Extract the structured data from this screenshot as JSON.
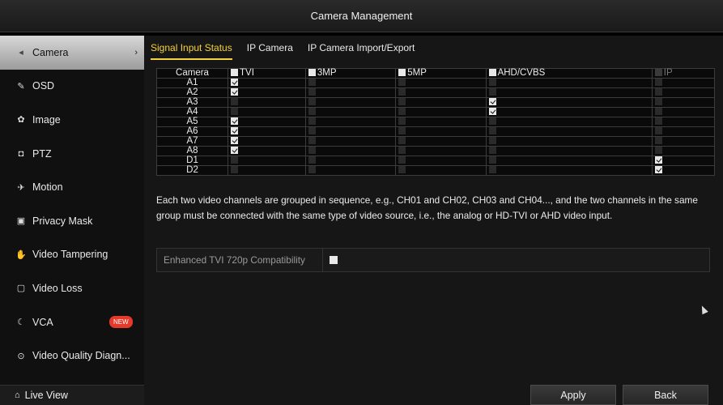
{
  "window": {
    "title": "Camera Management"
  },
  "sidebar": {
    "items": [
      {
        "label": "Camera",
        "icon": "camera-icon",
        "glyph": "◂",
        "active": true
      },
      {
        "label": "OSD",
        "icon": "osd-icon",
        "glyph": "✎"
      },
      {
        "label": "Image",
        "icon": "image-icon",
        "glyph": "✿"
      },
      {
        "label": "PTZ",
        "icon": "ptz-icon",
        "glyph": "◘"
      },
      {
        "label": "Motion",
        "icon": "motion-icon",
        "glyph": "✈"
      },
      {
        "label": "Privacy Mask",
        "icon": "privacy-mask-icon",
        "glyph": "▣"
      },
      {
        "label": "Video Tampering",
        "icon": "video-tampering-icon",
        "glyph": "✋"
      },
      {
        "label": "Video Loss",
        "icon": "video-loss-icon",
        "glyph": "▢"
      },
      {
        "label": "VCA",
        "icon": "vca-icon",
        "glyph": "☾",
        "badge": "NEW"
      },
      {
        "label": "Video Quality Diagn...",
        "icon": "video-quality-icon",
        "glyph": "⊙"
      }
    ],
    "live_view": {
      "label": "Live View",
      "icon": "home-icon",
      "glyph": "⌂"
    }
  },
  "tabs": [
    {
      "label": "Signal Input Status",
      "active": true
    },
    {
      "label": "IP Camera"
    },
    {
      "label": "IP Camera Import/Export"
    }
  ],
  "table": {
    "headers": [
      {
        "label": "Camera"
      },
      {
        "label": "TVI",
        "checked": true
      },
      {
        "label": "3MP",
        "checked": true
      },
      {
        "label": "5MP",
        "checked": true
      },
      {
        "label": "AHD/CVBS",
        "checked": true
      },
      {
        "label": "IP",
        "checked": false,
        "dim": true
      }
    ],
    "rows": [
      {
        "camera": "A1",
        "values": [
          true,
          false,
          false,
          false,
          false
        ]
      },
      {
        "camera": "A2",
        "values": [
          true,
          false,
          false,
          false,
          false
        ]
      },
      {
        "camera": "A3",
        "values": [
          false,
          false,
          false,
          true,
          false
        ]
      },
      {
        "camera": "A4",
        "values": [
          false,
          false,
          false,
          true,
          false
        ]
      },
      {
        "camera": "A5",
        "values": [
          true,
          false,
          false,
          false,
          false
        ]
      },
      {
        "camera": "A6",
        "values": [
          true,
          false,
          false,
          false,
          false
        ]
      },
      {
        "camera": "A7",
        "values": [
          true,
          false,
          false,
          false,
          false
        ]
      },
      {
        "camera": "A8",
        "values": [
          true,
          false,
          false,
          false,
          false
        ]
      },
      {
        "camera": "D1",
        "values": [
          false,
          false,
          false,
          false,
          true
        ]
      },
      {
        "camera": "D2",
        "values": [
          false,
          false,
          false,
          false,
          true
        ]
      }
    ]
  },
  "note": "Each two video channels are grouped in sequence, e.g., CH01 and CH02, CH03 and CH04..., and the two channels in the same group must be connected with the same type of video source, i.e., the analog or HD-TVI or AHD video input.",
  "option": {
    "label": "Enhanced TVI 720p Compatibility",
    "checked": true
  },
  "buttons": {
    "apply": "Apply",
    "back": "Back"
  }
}
